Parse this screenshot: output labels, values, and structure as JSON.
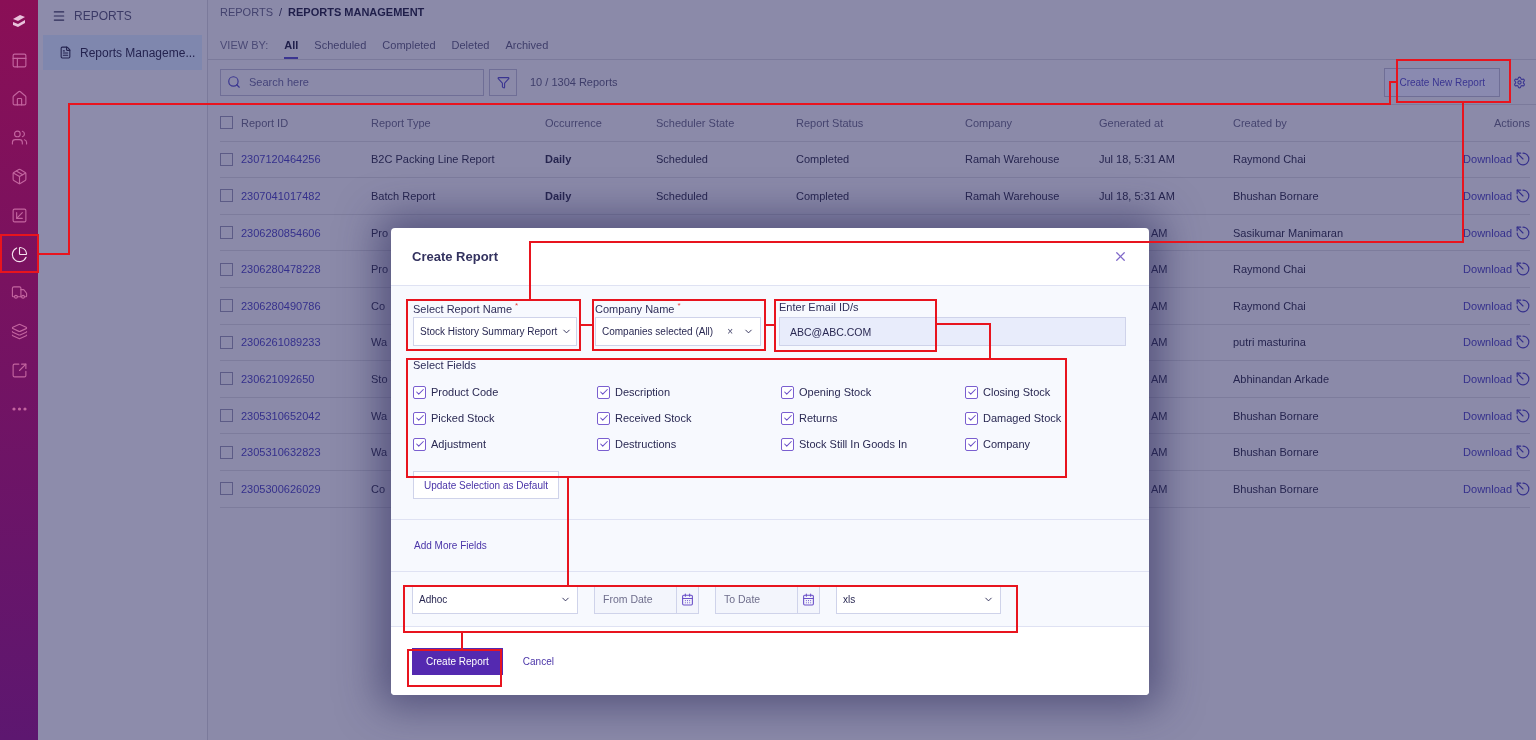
{
  "rail": [
    {
      "selected": false
    },
    {
      "selected": false
    },
    {
      "selected": false
    },
    {
      "selected": false
    },
    {
      "selected": false
    },
    {
      "selected": true
    },
    {
      "selected": false
    },
    {
      "selected": false
    },
    {
      "selected": false
    },
    {
      "selected": false
    }
  ],
  "sidebar": {
    "title": "REPORTS",
    "items": [
      {
        "label": "Reports Manageme...",
        "selected": true
      }
    ]
  },
  "breadcrumb": {
    "items": [
      "REPORTS",
      "REPORTS MANAGEMENT"
    ],
    "separator": "/"
  },
  "view_by": {
    "label": "VIEW BY:",
    "tabs": [
      {
        "label": "All",
        "selected": true
      },
      {
        "label": "Scheduled",
        "selected": false
      },
      {
        "label": "Completed",
        "selected": false
      },
      {
        "label": "Deleted",
        "selected": false
      },
      {
        "label": "Archived",
        "selected": false
      }
    ]
  },
  "toolbar": {
    "search_placeholder": "Search here",
    "count": "10 / 1304 Reports",
    "create_button": "Create New Report"
  },
  "table": {
    "select_all_checked": false,
    "columns": [
      "Report ID",
      "Report Type",
      "Occurrence",
      "Scheduler State",
      "Report Status",
      "Company",
      "Generated at",
      "Created by",
      "Actions"
    ],
    "rows": [
      {
        "kind": "full",
        "checked": false,
        "id": "2307120464256",
        "type": "B2C Packing Line Report",
        "occurrence": "Daily",
        "scheduler": "Scheduled",
        "status": "Completed",
        "company": "Ramah Warehouse",
        "generated": "Jul 18, 5:31 AM",
        "created_by": "Raymond Chai",
        "action": "Download"
      },
      {
        "kind": "full",
        "checked": false,
        "id": "2307041017482",
        "type": "Batch Report",
        "occurrence": "Daily",
        "scheduler": "Scheduled",
        "status": "Completed",
        "company": "Ramah Warehouse",
        "generated": "Jul 18, 5:31 AM",
        "created_by": "Bhushan Bornare",
        "action": "Download"
      },
      {
        "kind": "covered",
        "checked": false,
        "id": "2306280854606",
        "type": "Pro",
        "generated": "AM",
        "created_by": "Sasikumar Manimaran",
        "action": "Download"
      },
      {
        "kind": "covered",
        "checked": false,
        "id": "2306280478228",
        "type": "Pro",
        "generated": "AM",
        "created_by": "Raymond Chai",
        "action": "Download"
      },
      {
        "kind": "covered",
        "checked": false,
        "id": "2306280490786",
        "type": "Co",
        "generated": "AM",
        "created_by": "Raymond Chai",
        "action": "Download"
      },
      {
        "kind": "covered",
        "checked": false,
        "id": "2306261089233",
        "type": "Wa",
        "generated": "AM",
        "created_by": "putri masturina",
        "action": "Download"
      },
      {
        "kind": "covered",
        "checked": false,
        "id": "230621092650",
        "type": "Sto",
        "generated": "AM",
        "created_by": "Abhinandan Arkade",
        "action": "Download"
      },
      {
        "kind": "covered",
        "checked": false,
        "id": "2305310652042",
        "type": "Wa",
        "generated": "AM",
        "created_by": "Bhushan Bornare",
        "action": "Download"
      },
      {
        "kind": "covered",
        "checked": false,
        "id": "2305310632823",
        "type": "Wa",
        "generated": "AM",
        "created_by": "Bhushan Bornare",
        "action": "Download"
      },
      {
        "kind": "covered",
        "checked": false,
        "id": "2305300626029",
        "type": "Co",
        "generated": "AM",
        "created_by": "Bhushan Bornare",
        "action": "Download"
      }
    ]
  },
  "modal": {
    "title": "Create Report",
    "report_name": {
      "label": "Select Report Name $^{*}$",
      "value": "Stock History Summary Report"
    },
    "company": {
      "label": "Company Name $^{*}$",
      "value": "Companies selected (All)",
      "clear": "×"
    },
    "email": {
      "label": "Enter Email ID/s",
      "value": "ABC@ABC.COM"
    },
    "select_fields": {
      "title": "Select Fields",
      "options": [
        {
          "label": "Product Code",
          "checked": true
        },
        {
          "label": "Description",
          "checked": true
        },
        {
          "label": "Opening Stock",
          "checked": true
        },
        {
          "label": "Closing Stock",
          "checked": true
        },
        {
          "label": "Picked Stock",
          "checked": true
        },
        {
          "label": "Received Stock",
          "checked": true
        },
        {
          "label": "Returns",
          "checked": true
        },
        {
          "label": "Damaged Stock",
          "checked": true
        },
        {
          "label": "Adjustment",
          "checked": true
        },
        {
          "label": "Destructions",
          "checked": true
        },
        {
          "label": "Stock Still In Goods In",
          "checked": true
        },
        {
          "label": "Company",
          "checked": true
        }
      ]
    },
    "update_button": "Update Selection as Default",
    "add_more_link": "Add More Fields",
    "schedule": {
      "value": "Adhoc"
    },
    "from_date": {
      "placeholder": "From Date"
    },
    "to_date": {
      "placeholder": "To Date"
    },
    "format": {
      "value": "xls"
    },
    "submit": "Create Report",
    "cancel": "Cancel"
  }
}
